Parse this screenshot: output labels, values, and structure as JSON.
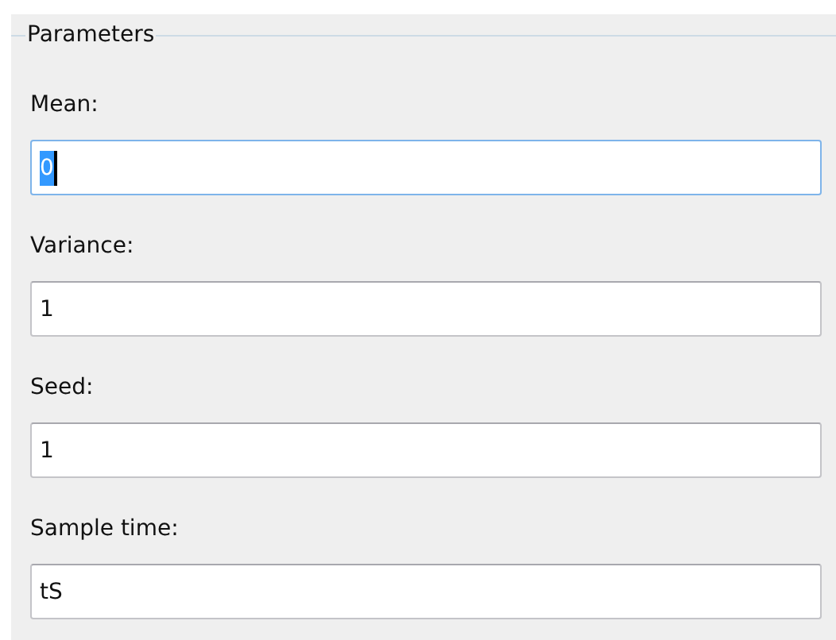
{
  "group": {
    "title": "Parameters"
  },
  "fields": [
    {
      "label": "Mean:",
      "value": "0",
      "focused": true
    },
    {
      "label": "Variance:",
      "value": "1",
      "focused": false
    },
    {
      "label": "Seed:",
      "value": "1",
      "focused": false
    },
    {
      "label": "Sample time:",
      "value": "tS",
      "focused": false
    }
  ]
}
